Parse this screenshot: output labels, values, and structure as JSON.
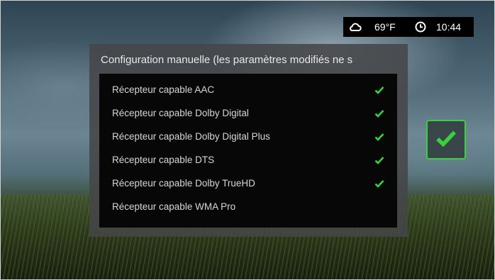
{
  "status": {
    "temperature": "69°F",
    "time": "10:44"
  },
  "dialog": {
    "title": "Configuration manuelle (les paramètres modifiés ne s",
    "items": [
      {
        "label": "Récepteur capable AAC",
        "checked": true
      },
      {
        "label": "Récepteur capable Dolby Digital",
        "checked": true
      },
      {
        "label": "Récepteur capable Dolby Digital Plus",
        "checked": true
      },
      {
        "label": "Récepteur capable DTS",
        "checked": true
      },
      {
        "label": "Récepteur capable Dolby TrueHD",
        "checked": true
      },
      {
        "label": "Récepteur capable WMA Pro",
        "checked": false
      }
    ]
  },
  "colors": {
    "accent": "#39d13d",
    "panel": "#464648",
    "list_bg": "#070707",
    "text": "#d7d7d7"
  },
  "icons": {
    "weather": "cloud-icon",
    "clock": "clock-icon",
    "check": "checkmark-icon"
  }
}
